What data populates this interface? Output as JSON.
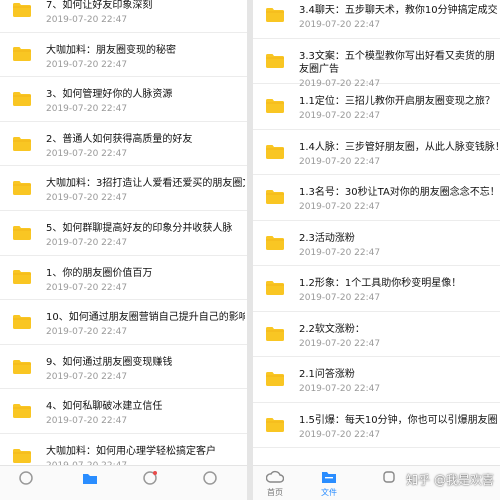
{
  "left_panel": {
    "items": [
      {
        "title": "7、如何让好友印象深刻",
        "date": "2019-07-20  22:47"
      },
      {
        "title": "大咖加料：朋友圈变现的秘密",
        "date": "2019-07-20  22:47"
      },
      {
        "title": "3、如何管理好你的人脉资源",
        "date": "2019-07-20  22:47"
      },
      {
        "title": "2、普通人如何获得高质量的好友",
        "date": "2019-07-20  22:47"
      },
      {
        "title": "大咖加料：3招打造让人爱看还爱买的朋友圈文",
        "date": "2019-07-20  22:47"
      },
      {
        "title": "5、如何群聊提高好友的印象分并收获人脉",
        "date": "2019-07-20  22:47"
      },
      {
        "title": "1、你的朋友圈价值百万",
        "date": "2019-07-20  22:47"
      },
      {
        "title": "10、如何通过朋友圈营销自己提升自己的影响力",
        "date": "2019-07-20  22:47"
      },
      {
        "title": "9、如何通过朋友圈变现赚钱",
        "date": "2019-07-20  22:47"
      },
      {
        "title": "4、如何私聊破冰建立信任",
        "date": "2019-07-20  22:47"
      },
      {
        "title": "大咖加料：如何用心理学轻松搞定客户",
        "date": "2019-07-20  22:47"
      }
    ]
  },
  "right_panel": {
    "items": [
      {
        "title": "3.4聊天：五步聊天术，教你10分钟搞定成交",
        "date": "2019-07-20  22:47",
        "tall": false
      },
      {
        "title": "3.3文案：五个模型教你写出好看又卖货的朋友圈广告",
        "date": "2019-07-20  22:47",
        "tall": true
      },
      {
        "title": "1.1定位：三招儿教你开启朋友圈变现之旅？",
        "date": "2019-07-20  22:47",
        "tall": false
      },
      {
        "title": "1.4人脉：三步管好朋友圈，从此人脉变钱脉！",
        "date": "2019-07-20  22:47",
        "tall": false
      },
      {
        "title": "1.3名号：30秒让TA对你的朋友圈念念不忘！",
        "date": "2019-07-20  22:47",
        "tall": false
      },
      {
        "title": "2.3活动涨粉",
        "date": "2019-07-20  22:47",
        "tall": false
      },
      {
        "title": "1.2形象：1个工具助你秒变明星像！",
        "date": "2019-07-20  22:47",
        "tall": false
      },
      {
        "title": "2.2软文涨粉：",
        "date": "2019-07-20  22:47",
        "tall": false
      },
      {
        "title": "2.1问答涨粉",
        "date": "2019-07-20  22:47",
        "tall": false
      },
      {
        "title": "1.5引爆：每天10分钟，你也可以引爆朋友圈！",
        "date": "2019-07-20  22:47",
        "tall": false
      }
    ],
    "bottom_nav": {
      "home_label": "首页",
      "files_label": "文件",
      "active_color": "#2a8dff"
    }
  },
  "watermark": "知乎 @我是欢喜",
  "colors": {
    "folder": "#f9c623",
    "folder_dark": "#f2b61a"
  }
}
